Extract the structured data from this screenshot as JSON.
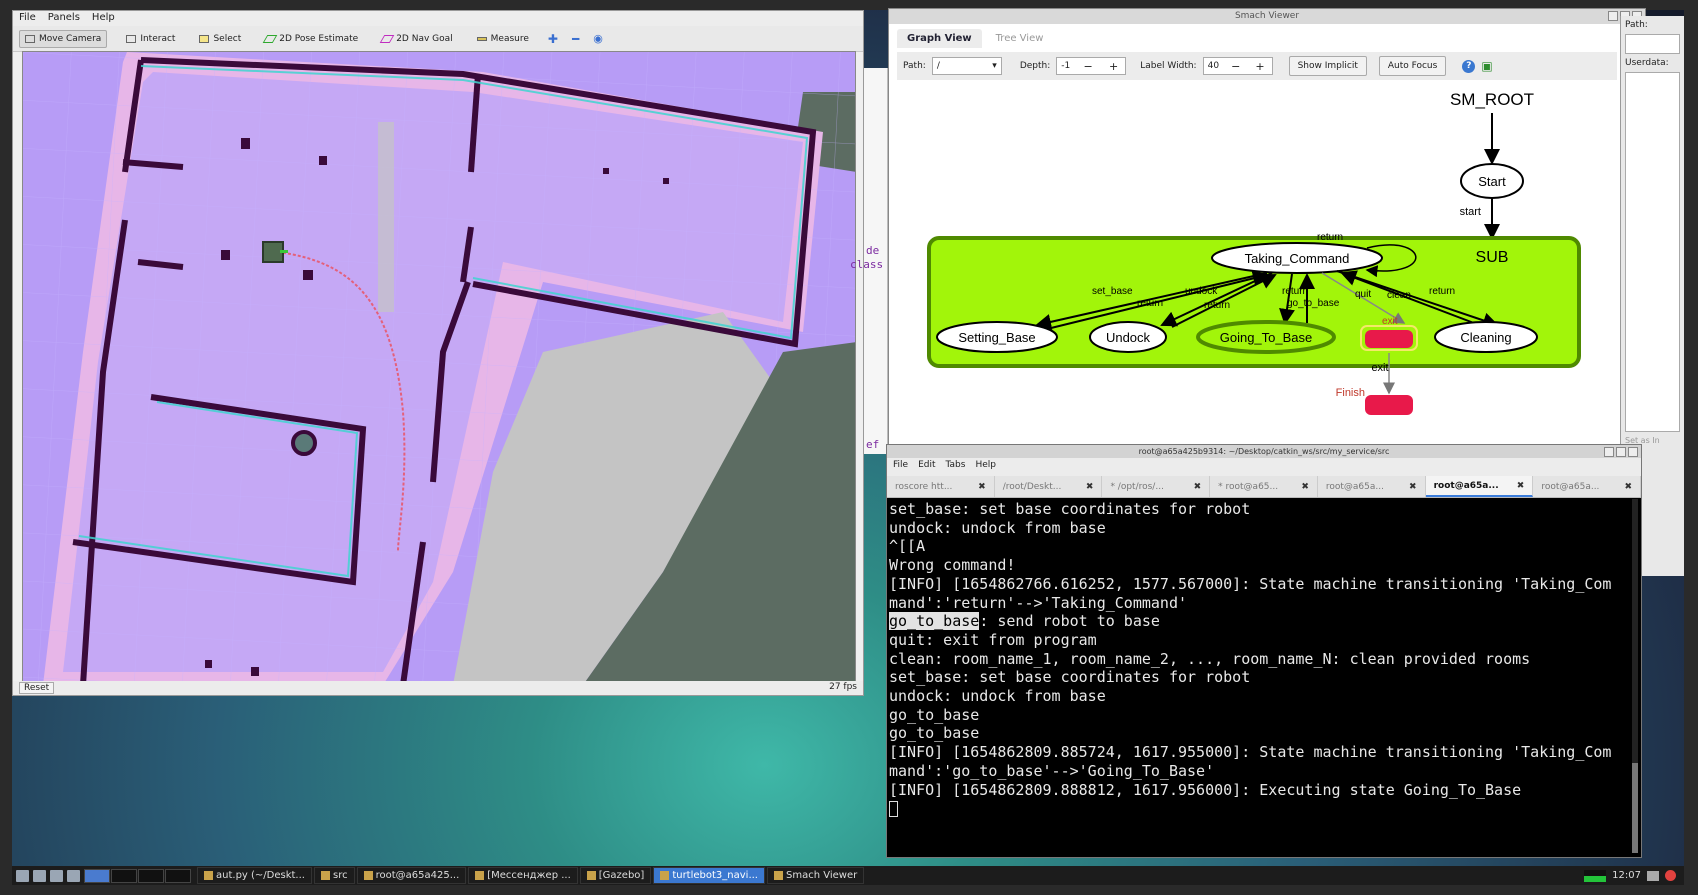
{
  "rviz": {
    "menu": [
      "File",
      "Panels",
      "Help"
    ],
    "tools": [
      {
        "label": "Move Camera",
        "icon": "move-camera-icon"
      },
      {
        "label": "Interact",
        "icon": "interact-icon"
      },
      {
        "label": "Select",
        "icon": "select-icon"
      },
      {
        "label": "2D Pose Estimate",
        "icon": "pose-estimate-icon"
      },
      {
        "label": "2D Nav Goal",
        "icon": "nav-goal-icon"
      },
      {
        "label": "Measure",
        "icon": "measure-icon"
      }
    ],
    "reset_label": "Reset",
    "fps": "27 fps"
  },
  "smach": {
    "title": "Smach Viewer",
    "tabs": [
      "Graph View",
      "Tree View"
    ],
    "path_label": "Path:",
    "path_value": "/",
    "depth_label": "Depth:",
    "depth_value": "-1",
    "label_width_label": "Label Width:",
    "label_width_value": "40",
    "show_implicit": "Show Implicit",
    "auto_focus": "Auto Focus",
    "graph": {
      "root": "SM_ROOT",
      "start": "Start",
      "start_edge": "start",
      "container": "SUB",
      "hub": "Taking_Command",
      "states": [
        "Setting_Base",
        "Undock",
        "Going_To_Base",
        "Cleaning"
      ],
      "edges": {
        "set_base": "set_base",
        "undock": "undock",
        "go_to_base": "go_to_base",
        "quit": "quit",
        "clean": "clean",
        "return": "return",
        "exit": "exit"
      },
      "finish": "Finish"
    },
    "side": {
      "path": "Path:",
      "userdata": "Userdata:",
      "set_as": "Set as In"
    }
  },
  "code_fragments": [
    "de",
    "class",
    "ef"
  ],
  "terminal": {
    "title": "root@a65a425b9314: ~/Desktop/catkin_ws/src/my_service/src",
    "menu": [
      "File",
      "Edit",
      "Tabs",
      "Help"
    ],
    "tabs": [
      "roscore htt...",
      "/root/Deskt...",
      "* /opt/ros/...",
      "* root@a65...",
      "root@a65a...",
      "root@a65a...",
      "root@a65a..."
    ],
    "active_tab_index": 5,
    "lines": [
      "set_base: set base coordinates for robot",
      "undock: undock from base",
      "",
      "^[[A",
      "Wrong command!",
      "[INFO] [1654862766.616252, 1577.567000]: State machine transitioning 'Taking_Com",
      "mand':'return'-->'Taking_Command'",
      "go_to_base: send robot to base",
      "quit: exit from program",
      "clean: room_name_1, room_name_2, ..., room_name_N: clean provided rooms",
      "set_base: set base coordinates for robot",
      "undock: undock from base",
      "",
      "go_to_base",
      "go_to_base",
      "[INFO] [1654862809.885724, 1617.955000]: State machine transitioning 'Taking_Com",
      "mand':'go_to_base'-->'Going_To_Base'",
      "[INFO] [1654862809.888812, 1617.956000]: Executing state Going_To_Base"
    ],
    "highlight_text": "go_to_base"
  },
  "taskbar": {
    "items": [
      "aut.py (~/Deskt...",
      "src",
      "root@a65a425...",
      "[Мессенджер ...",
      "[Gazebo]",
      "turtlebot3_navi...",
      "Smach Viewer"
    ],
    "active_index": 5,
    "clock": "12:07"
  },
  "colors": {
    "container_fill": "#a2f50a",
    "active_state_border": "#4f8a00",
    "finish_fill": "#e8194a",
    "terminal_bg": "#000000",
    "accent": "#3b78d0"
  }
}
